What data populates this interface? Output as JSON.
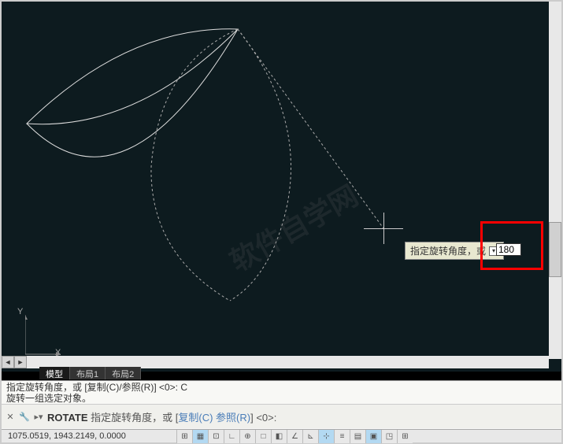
{
  "tooltip": {
    "text": "指定旋转角度，或",
    "input_value": "180"
  },
  "tabs": {
    "model": "模型",
    "layout1": "布局1",
    "layout2": "布局2"
  },
  "command": {
    "history_line1": "指定旋转角度，或 [复制(C)/参照(R)] <0>: C",
    "history_line2": "旋转一组选定对象。",
    "prompt_cmd": "ROTATE",
    "prompt_text": "指定旋转角度，或 [",
    "prompt_opt1": "复制(C)",
    "prompt_opt2": "参照(R)",
    "prompt_end": "] <0>:"
  },
  "status": {
    "coords": "1075.0519, 1943.2149, 0.0000"
  },
  "ucs": {
    "x_label": "X",
    "y_label": "Y"
  },
  "watermark": "软件自学网"
}
